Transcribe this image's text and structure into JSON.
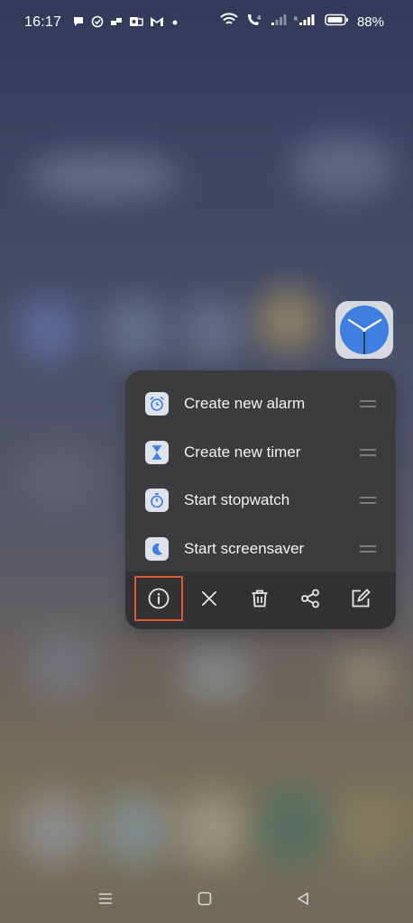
{
  "status_bar": {
    "time": "16:17",
    "battery_percent": "88%",
    "notification_icons": [
      "chat-bubble-icon",
      "check-circle-icon",
      "transfer-icon",
      "outlook-icon",
      "gmail-icon",
      "dot-icon"
    ],
    "system_icons": [
      "wifi-icon",
      "volte-call-icon",
      "signal-1-icon",
      "signal-2-icon",
      "battery-icon"
    ]
  },
  "app": {
    "name_icon": "clock-app-icon",
    "accent_color": "#3f7fe0"
  },
  "shortcut_menu": {
    "items": [
      {
        "label": "Create new alarm",
        "icon": "alarm-icon"
      },
      {
        "label": "Create new timer",
        "icon": "hourglass-icon"
      },
      {
        "label": "Start stopwatch",
        "icon": "stopwatch-icon"
      },
      {
        "label": "Start screensaver",
        "icon": "moon-icon"
      }
    ],
    "actions": [
      "info-icon",
      "close-icon",
      "trash-icon",
      "share-icon",
      "edit-icon"
    ],
    "highlighted_action": "info-icon",
    "highlight_color": "#e0583a"
  },
  "nav_bar": {
    "buttons": [
      "menu-icon",
      "home-icon",
      "back-icon"
    ]
  }
}
